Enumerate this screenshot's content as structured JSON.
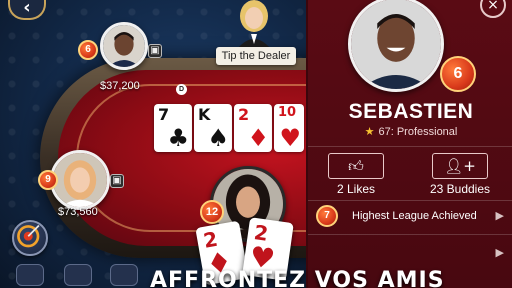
{
  "table": {
    "back_label": "‹",
    "tip_dealer_label": "Tip the Dealer",
    "dealer_button_label": "D",
    "players": [
      {
        "chips": "$37,200",
        "level": "6"
      },
      {
        "chips": "$73,560",
        "level": "9"
      },
      {
        "level": "12"
      }
    ],
    "community_cards": [
      {
        "rank": "7",
        "suit": "♣",
        "color": "black"
      },
      {
        "rank": "K",
        "suit": "♠",
        "color": "black"
      },
      {
        "rank": "2",
        "suit": "♦",
        "color": "red"
      },
      {
        "rank": "10",
        "suit": "♥",
        "color": "red"
      }
    ],
    "hole_cards": [
      {
        "rank": "2",
        "suit": "♦"
      },
      {
        "rank": "2",
        "suit": "♥"
      }
    ]
  },
  "profile": {
    "close_label": "×",
    "name": "SEBASTIEN",
    "level": "6",
    "league_text": "67: Professional",
    "likes_label": "2 Likes",
    "buddies_label": "23 Buddies",
    "league_badge_level": "7",
    "achievement_text": "Highest League Achieved"
  },
  "caption": "AFFRONTEZ VOS AMIS",
  "colors": {
    "felt": "#c3131f",
    "panel": "#5a0b14",
    "badge": "#d93a1b"
  },
  "icons": [
    "back-icon",
    "gift-icon",
    "target-icon",
    "friends-icon",
    "chat-icon",
    "thumbs-up-icon",
    "add-buddy-icon",
    "star-icon",
    "chevron-right-icon",
    "close-icon"
  ]
}
